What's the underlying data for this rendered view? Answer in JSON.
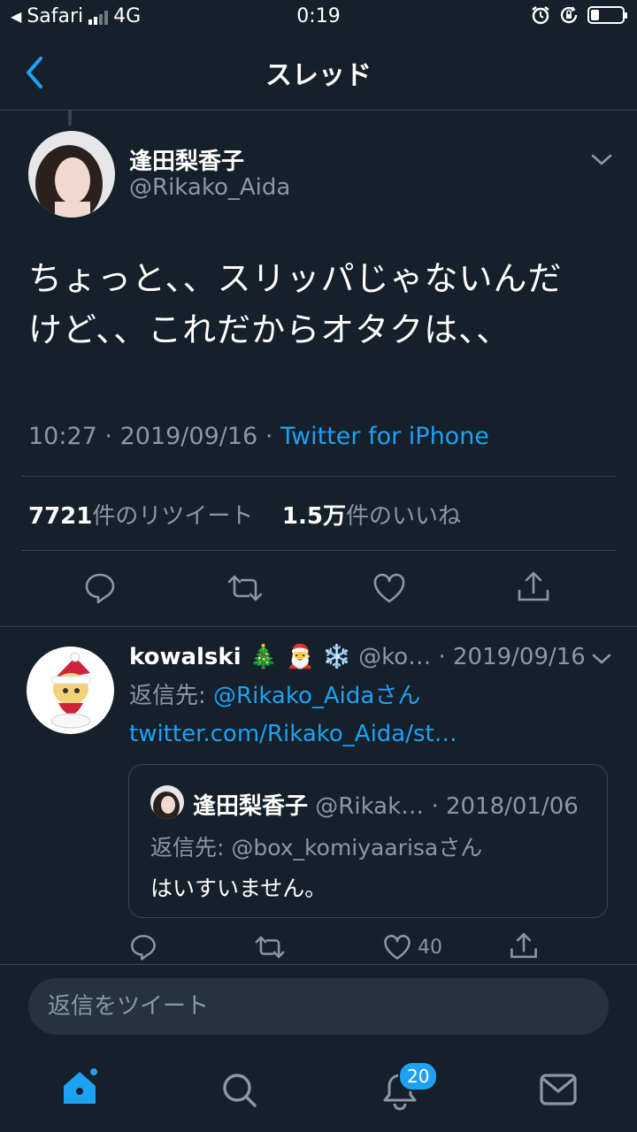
{
  "status_bar": {
    "back_app": "Safari",
    "network": "4G",
    "time": "0:19",
    "signal_bars": 2,
    "battery_level": 0.25
  },
  "nav": {
    "title": "スレッド",
    "back_icon": "chevron-left-icon"
  },
  "main_tweet": {
    "display_name": "逢田梨香子",
    "handle": "@Rikako_Aida",
    "text_line1": "ちょっと、、スリッパじゃないんだ",
    "text_line2": "けど、、これだからオタクは、、",
    "time": "10:27",
    "date": "2019/09/16",
    "sep": "·",
    "source": "Twitter for iPhone",
    "retweets_count": "7721",
    "retweets_label": "件のリツイート",
    "likes_count": "1.5万",
    "likes_label": "件のいいね"
  },
  "reply_tweet": {
    "display_name": "kowalski 🎄 🎅 ❄️",
    "handle": "@ko…",
    "date": "· 2019/09/16",
    "reply_to_label": "返信先: ",
    "reply_to_handle": "@Rikako_Aidaさん",
    "link": "twitter.com/Rikako_Aida/st…",
    "likes": "40"
  },
  "quoted_tweet": {
    "display_name": "逢田梨香子",
    "handle": "@Rikak…",
    "date": "· 2018/01/06",
    "reply_to": "返信先: @box_komiyaarisaさん",
    "text": "はいすいません。"
  },
  "composer": {
    "placeholder": "返信をツイート"
  },
  "tabbar": {
    "notifications_badge": "20"
  },
  "colors": {
    "background": "#15202b",
    "accent": "#1da1f2",
    "muted": "#8899a6",
    "border": "#38444d"
  }
}
